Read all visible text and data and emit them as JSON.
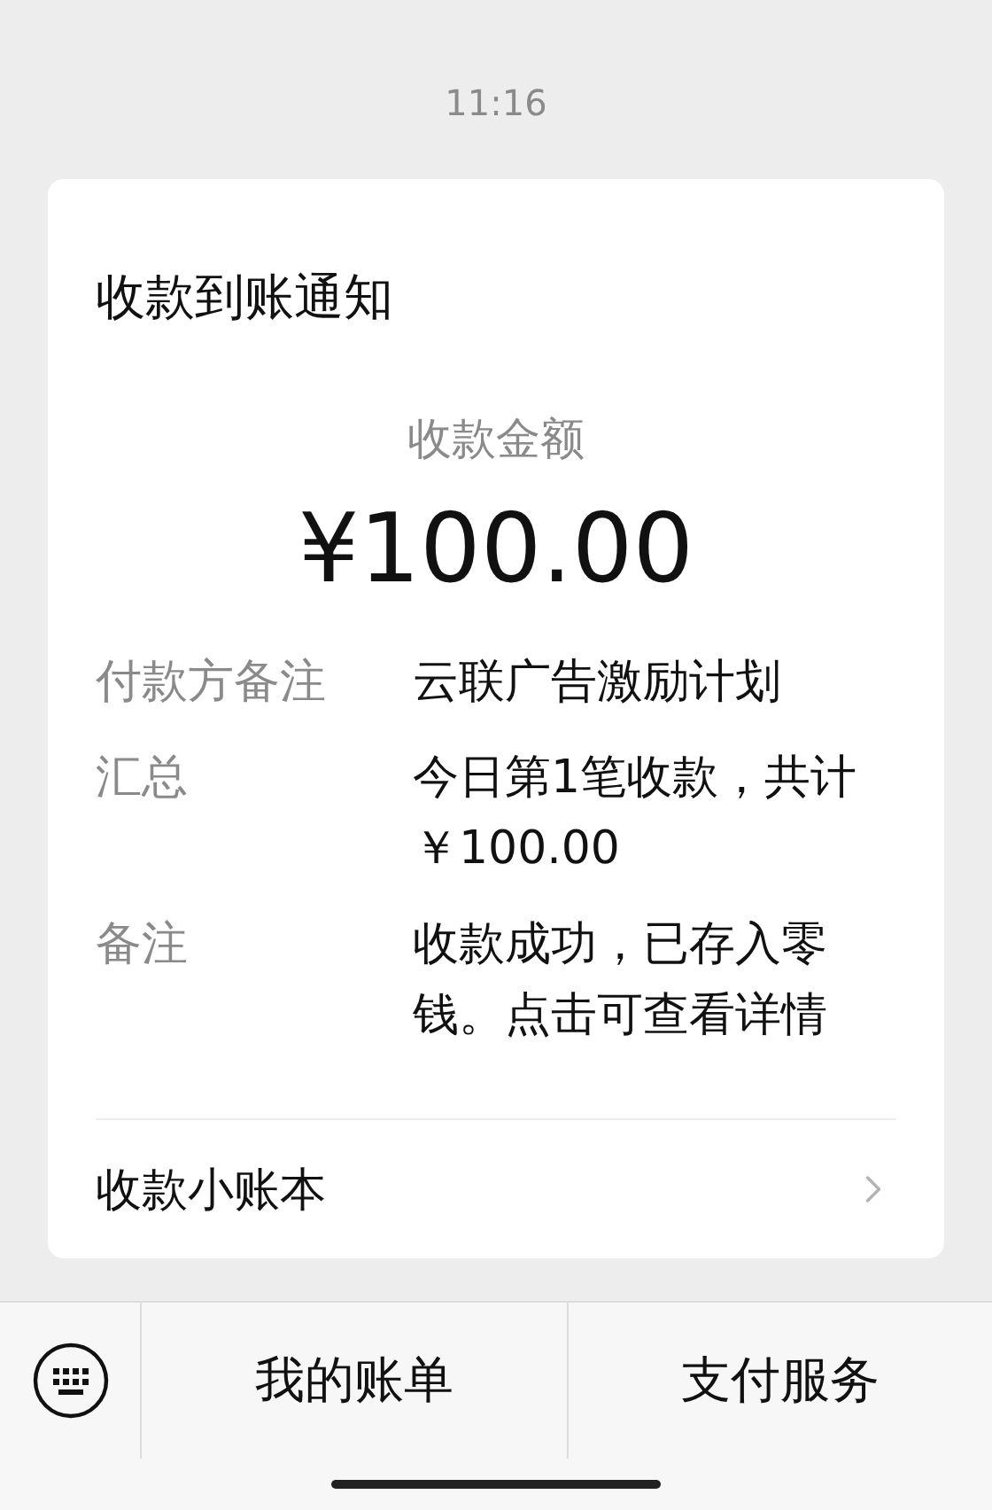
{
  "time": "11:16",
  "card": {
    "title": "收款到账通知",
    "amount_label": "收款金额",
    "amount": "¥100.00",
    "rows": [
      {
        "label": "付款方备注",
        "value": "云联广告激励计划"
      },
      {
        "label": "汇总",
        "value": "今日第1笔收款，共计￥100.00"
      },
      {
        "label": "备注",
        "value": "收款成功，已存入零钱。点击可查看详情"
      }
    ],
    "link": "收款小账本"
  },
  "bottom_bar": {
    "menus": [
      "我的账单",
      "支付服务"
    ]
  }
}
